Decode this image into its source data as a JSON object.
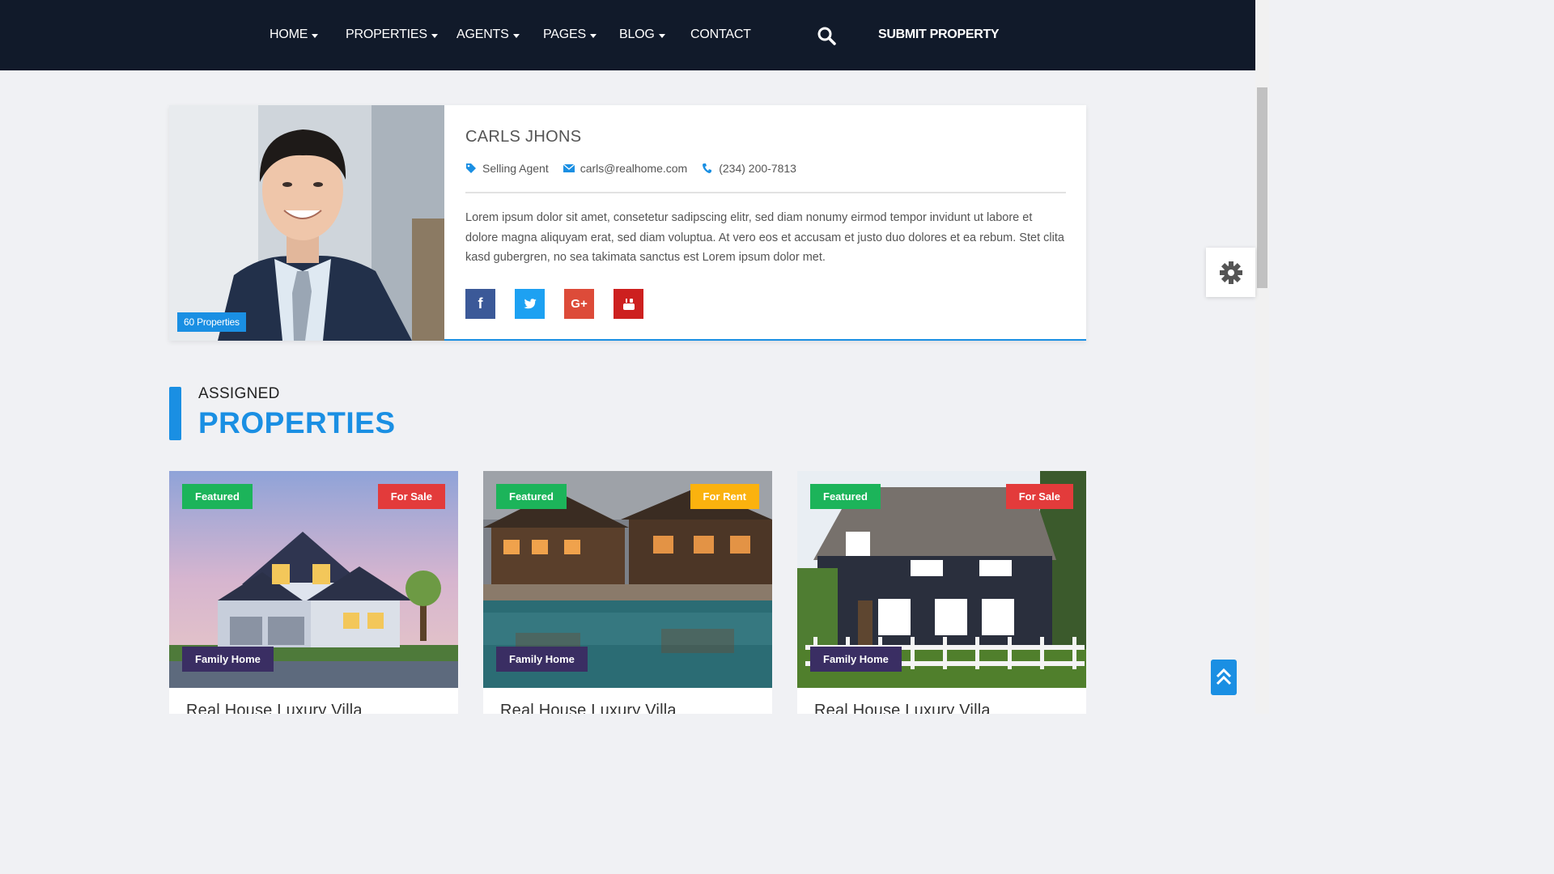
{
  "nav": {
    "items": [
      {
        "label": "HOME",
        "dropdown": true
      },
      {
        "label": "PROPERTIES",
        "dropdown": true
      },
      {
        "label": "AGENTS",
        "dropdown": true
      },
      {
        "label": "PAGES",
        "dropdown": true
      },
      {
        "label": "BLOG",
        "dropdown": true
      },
      {
        "label": "CONTACT",
        "dropdown": false
      }
    ],
    "submit_label": "SUBMIT PROPERTY",
    "search_icon": "search-icon"
  },
  "agent": {
    "name": "CARLS JHONS",
    "role": "Selling Agent",
    "email": "carls@realhome.com",
    "phone": "(234) 200-7813",
    "property_count": "60 Properties",
    "bio": "Lorem ipsum dolor sit amet, consetetur sadipscing elitr, sed diam nonumy eirmod tempor invidunt ut labore et dolore magna aliquyam erat, sed diam voluptua. At vero eos et accusam et justo duo dolores et ea rebum. Stet clita kasd gubergren, no sea takimata sanctus est Lorem ipsum dolor met.",
    "socials": {
      "facebook": "f",
      "twitter": "t",
      "google": "G+",
      "youtube": "You Tube"
    }
  },
  "section": {
    "small": "ASSIGNED",
    "big": "PROPERTIES"
  },
  "properties": [
    {
      "featured": "Featured",
      "status": "For Sale",
      "status_color": "#e33b3b",
      "type": "Family Home",
      "title": "Real House Luxury Villa"
    },
    {
      "featured": "Featured",
      "status": "For Rent",
      "status_color": "#fbb20e",
      "type": "Family Home",
      "title": "Real House Luxury Villa"
    },
    {
      "featured": "Featured",
      "status": "For Sale",
      "status_color": "#e33b3b",
      "type": "Family Home",
      "title": "Real House Luxury Villa"
    }
  ],
  "colors": {
    "accent": "#1a8fe3",
    "nav_bg": "#111a2a",
    "featured": "#1cb45a",
    "type_badge": "#3a2e63"
  }
}
